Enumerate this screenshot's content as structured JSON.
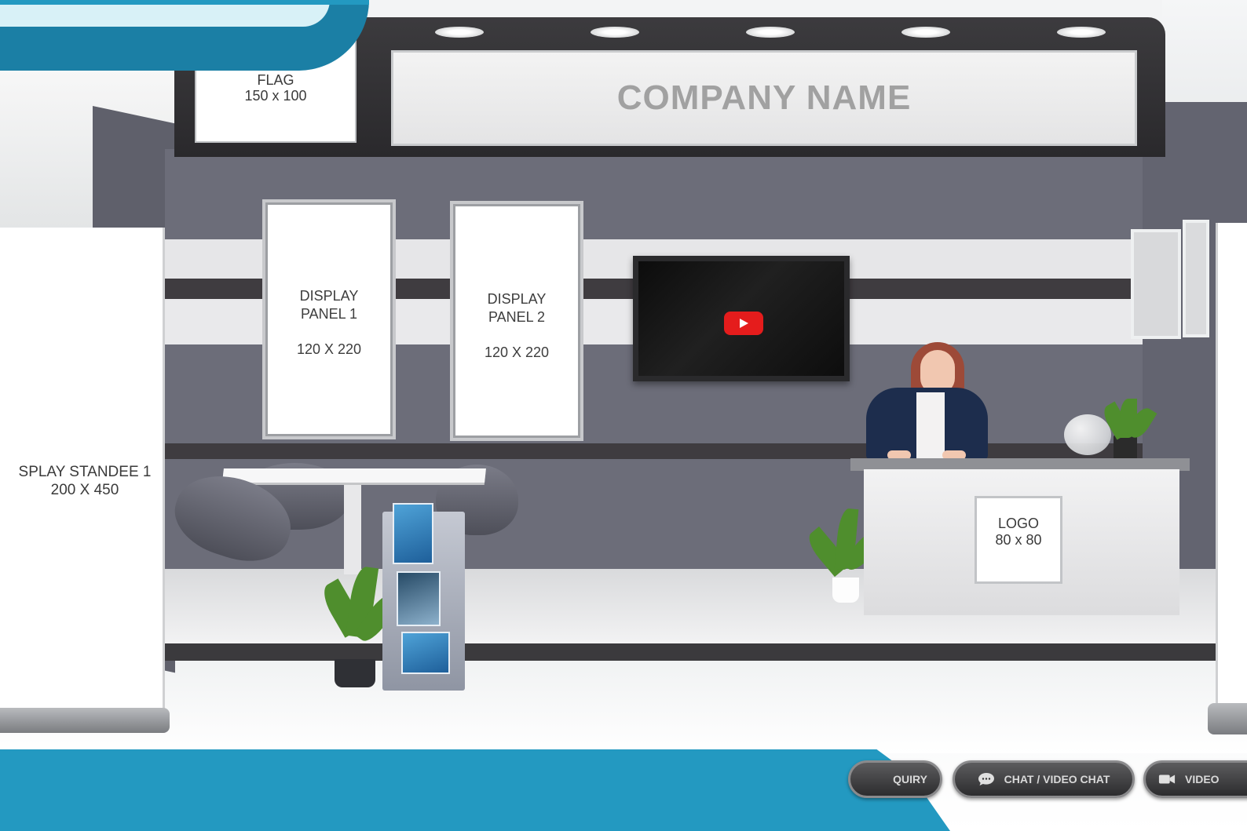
{
  "booth": {
    "flag": {
      "label": "FLAG",
      "size": "150 x 100"
    },
    "company_name": "COMPANY NAME",
    "display_panels": [
      {
        "label_line1": "DISPLAY",
        "label_line2": "PANEL 1",
        "size": "120  X 220"
      },
      {
        "label_line1": "DISPLAY",
        "label_line2": "PANEL 2",
        "size": "120  X 220"
      }
    ],
    "standee": {
      "label": "SPLAY STANDEE 1",
      "size": "200 X 450"
    },
    "logo": {
      "label": "LOGO",
      "size": "80 x 80"
    },
    "video_icon": "youtube-play-icon"
  },
  "actions": {
    "enquiry_label": "QUIRY",
    "chat_label": "CHAT / VIDEO CHAT",
    "video_label": "VIDEO"
  },
  "colors": {
    "banner_teal": "#2399c1",
    "banner_dark": "#1b7fa5",
    "wall": "#6c6d79",
    "youtube_red": "#e51c1c"
  }
}
